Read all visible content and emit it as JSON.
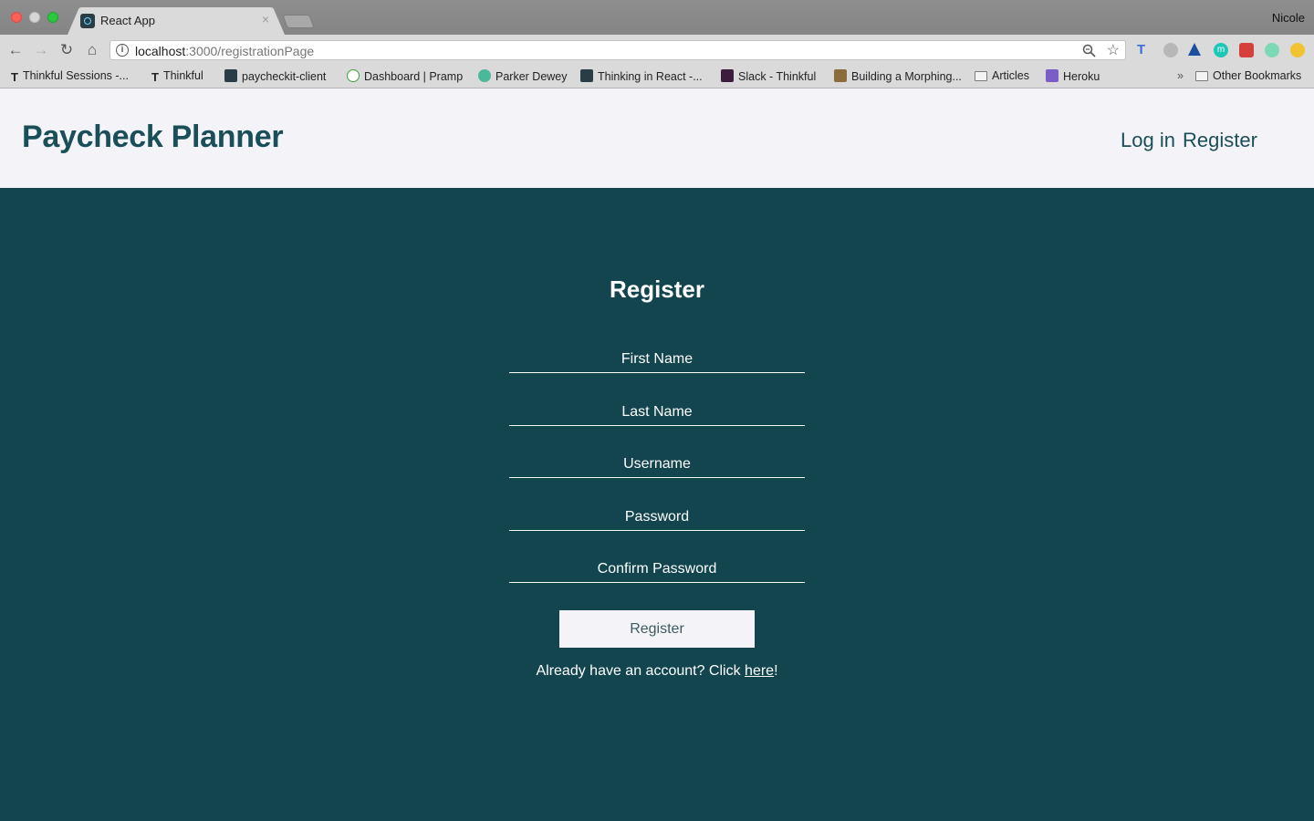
{
  "browser": {
    "tab_title": "React App",
    "tab_close": "×",
    "profile": "Nicole",
    "url_host": "localhost",
    "url_path": ":3000/registrationPage",
    "nav": {
      "back": "←",
      "forward": "→",
      "reload": "↻",
      "home": "⌂"
    },
    "bookmarks": [
      "Thinkful Sessions -...",
      "Thinkful",
      "paycheckit-client",
      "Dashboard | Pramp",
      "Parker Dewey",
      "Thinking in React -...",
      "Slack - Thinkful",
      "Building a Morphing...",
      "Articles",
      "Heroku"
    ],
    "bookmarks_more": "»",
    "other_bookmarks": "Other Bookmarks"
  },
  "header": {
    "brand": "Paycheck Planner",
    "nav_login": "Log in",
    "nav_register": "Register"
  },
  "form": {
    "title": "Register",
    "fields": {
      "first_name": "First Name",
      "last_name": "Last Name",
      "username": "Username",
      "password": "Password",
      "confirm_password": "Confirm Password"
    },
    "submit_label": "Register",
    "prompt_before": "Already have an account? Click ",
    "prompt_link": "here",
    "prompt_after": "!"
  },
  "colors": {
    "page_background": "#12454e",
    "header_background": "#f4f4f8",
    "brand_text": "#1a4f5a",
    "form_text": "#ffffff"
  }
}
